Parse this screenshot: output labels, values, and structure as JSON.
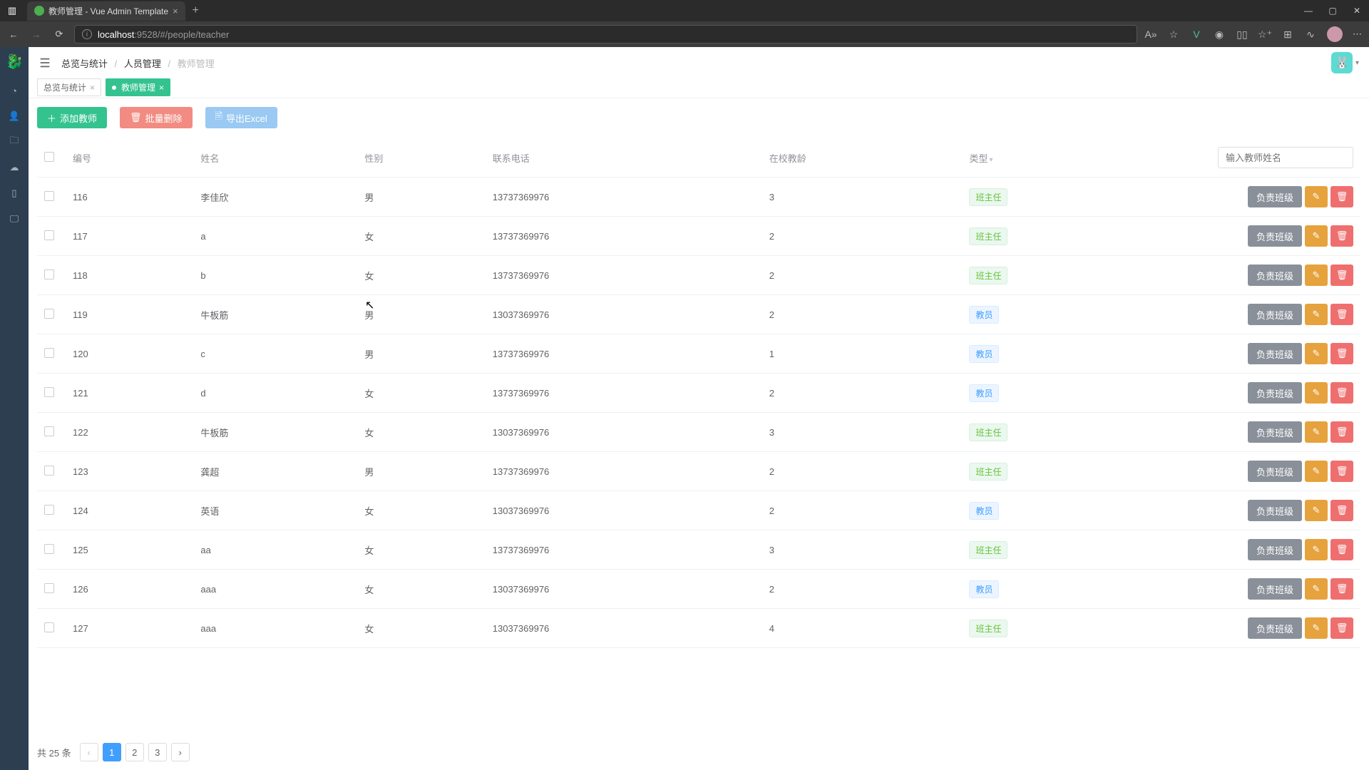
{
  "browser": {
    "tab_title": "教师管理 - Vue Admin Template",
    "url_host": "localhost",
    "url_port_path": ":9528/#/people/teacher"
  },
  "breadcrumb": {
    "overview": "总览与统计",
    "people": "人员管理",
    "current": "教师管理"
  },
  "tabs": {
    "overview": "总览与统计",
    "teacher": "教师管理"
  },
  "toolbar": {
    "add": "添加教师",
    "bulk_delete": "批量删除",
    "export": "导出Excel"
  },
  "search": {
    "placeholder": "输入教师姓名"
  },
  "columns": {
    "id": "编号",
    "name": "姓名",
    "gender": "性别",
    "phone": "联系电话",
    "tenure": "在校教龄",
    "type": "类型"
  },
  "type_labels": {
    "class": "班主任",
    "teacher": "教员"
  },
  "row_action_labels": {
    "assign": "负责班级"
  },
  "rows": [
    {
      "id": "116",
      "name": "李佳欣",
      "gender": "男",
      "phone": "13737369976",
      "tenure": "3",
      "type": "class"
    },
    {
      "id": "117",
      "name": "a",
      "gender": "女",
      "phone": "13737369976",
      "tenure": "2",
      "type": "class"
    },
    {
      "id": "118",
      "name": "b",
      "gender": "女",
      "phone": "13737369976",
      "tenure": "2",
      "type": "class"
    },
    {
      "id": "119",
      "name": "牛板筋",
      "gender": "男",
      "phone": "13037369976",
      "tenure": "2",
      "type": "teacher"
    },
    {
      "id": "120",
      "name": "c",
      "gender": "男",
      "phone": "13737369976",
      "tenure": "1",
      "type": "teacher"
    },
    {
      "id": "121",
      "name": "d",
      "gender": "女",
      "phone": "13737369976",
      "tenure": "2",
      "type": "teacher"
    },
    {
      "id": "122",
      "name": "牛板筋",
      "gender": "女",
      "phone": "13037369976",
      "tenure": "3",
      "type": "class"
    },
    {
      "id": "123",
      "name": "龚超",
      "gender": "男",
      "phone": "13737369976",
      "tenure": "2",
      "type": "class"
    },
    {
      "id": "124",
      "name": "英语",
      "gender": "女",
      "phone": "13037369976",
      "tenure": "2",
      "type": "teacher"
    },
    {
      "id": "125",
      "name": "aa",
      "gender": "女",
      "phone": "13737369976",
      "tenure": "3",
      "type": "class"
    },
    {
      "id": "126",
      "name": "aaa",
      "gender": "女",
      "phone": "13037369976",
      "tenure": "2",
      "type": "teacher"
    },
    {
      "id": "127",
      "name": "aaa",
      "gender": "女",
      "phone": "13037369976",
      "tenure": "4",
      "type": "class"
    }
  ],
  "pagination": {
    "total_label": "共 25 条",
    "pages": [
      "1",
      "2",
      "3"
    ],
    "current": "1"
  }
}
